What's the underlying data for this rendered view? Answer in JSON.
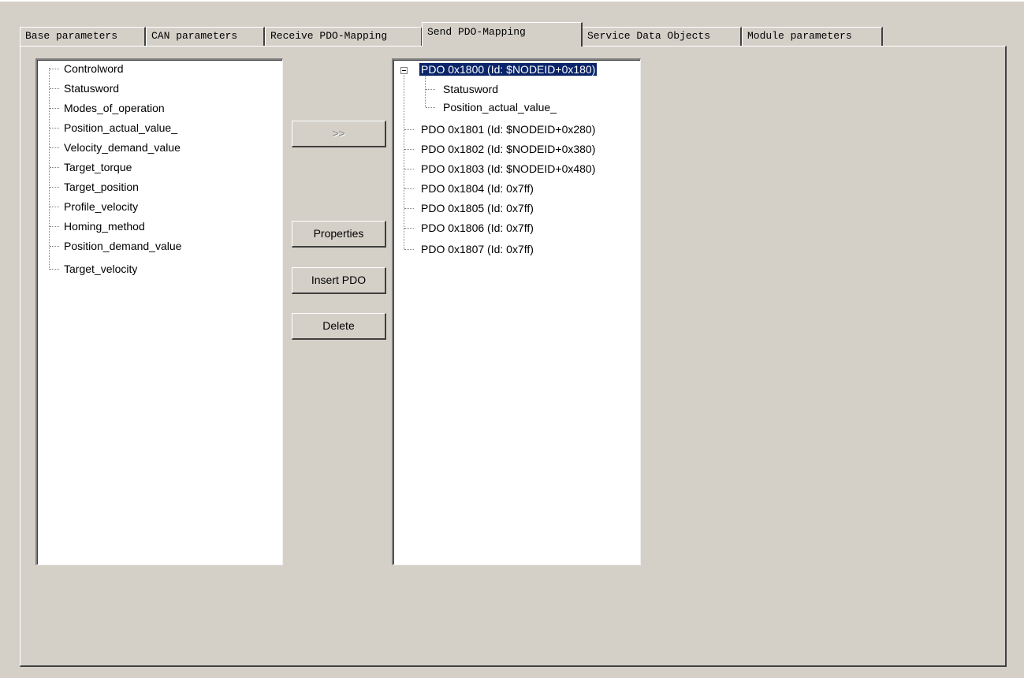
{
  "tabs": [
    {
      "label": "Base parameters"
    },
    {
      "label": "CAN parameters"
    },
    {
      "label": "Receive PDO-Mapping"
    },
    {
      "label": "Send PDO-Mapping"
    },
    {
      "label": "Service Data Objects"
    },
    {
      "label": "Module parameters"
    }
  ],
  "active_tab": "Send PDO-Mapping",
  "left_tree": {
    "items": [
      "Controlword",
      "Statusword",
      "Modes_of_operation",
      "Position_actual_value_",
      "Velocity_demand_value",
      "Target_torque",
      "Target_position",
      "Profile_velocity",
      "Homing_method",
      "Position_demand_value",
      "Target_velocity"
    ]
  },
  "buttons": {
    "add": ">>",
    "properties": "Properties",
    "insert_pdo": "Insert PDO",
    "delete": "Delete"
  },
  "right_tree": {
    "root": {
      "label": "PDO 0x1800 (Id: $NODEID+0x180)",
      "selected": true,
      "expanded": true,
      "children": [
        "Statusword",
        "Position_actual_value_"
      ]
    },
    "pdos": [
      "PDO 0x1801 (Id: $NODEID+0x280)",
      "PDO 0x1802 (Id: $NODEID+0x380)",
      "PDO 0x1803 (Id: $NODEID+0x480)",
      "PDO 0x1804 (Id: 0x7ff)",
      "PDO 0x1805 (Id: 0x7ff)",
      "PDO 0x1806 (Id: 0x7ff)",
      "PDO 0x1807 (Id: 0x7ff)"
    ]
  }
}
